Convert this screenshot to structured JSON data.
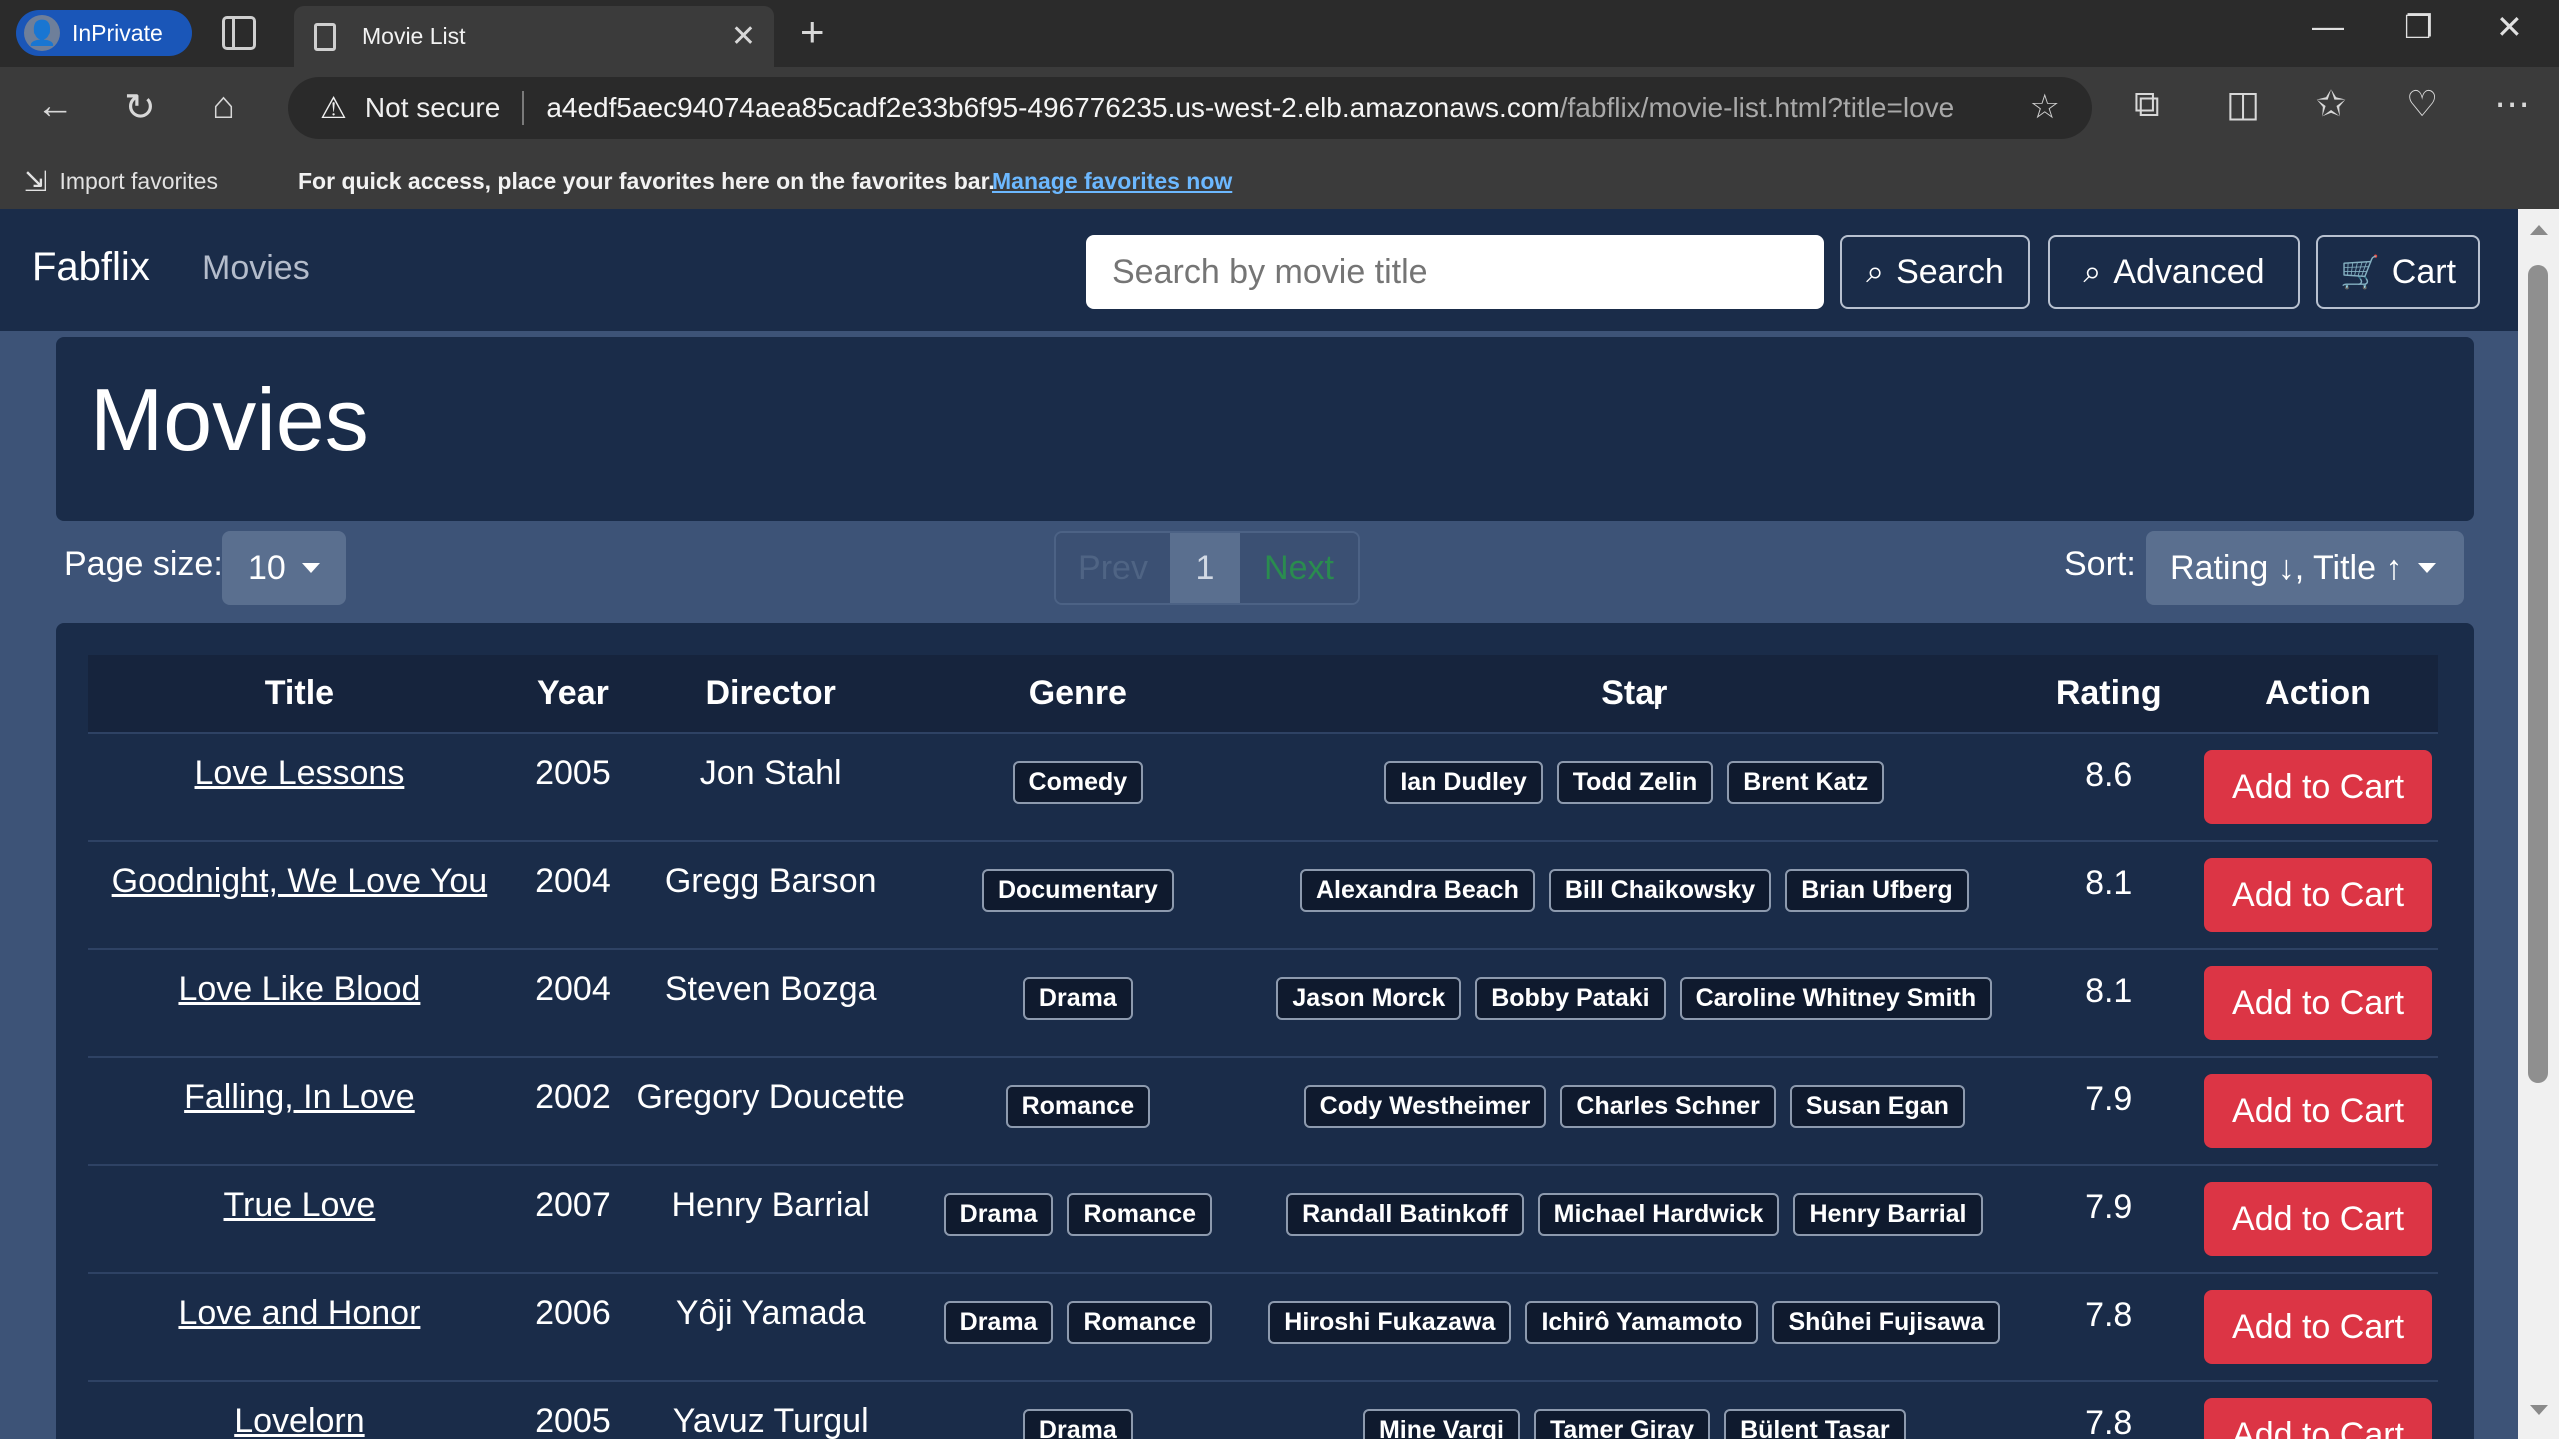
{
  "browser": {
    "inprivate_label": "InPrivate",
    "tab_title": "Movie List",
    "tab_close": "✕",
    "new_tab": "+",
    "security_label": "Not secure",
    "url_host": "a4edf5aec94074aea85cadf2e33b6f95-496776235.us-west-2.elb.amazonaws.com",
    "url_path": "/fabflix/movie-list.html?title=love",
    "favbar_import": "Import favorites",
    "favbar_message": "For quick access, place your favorites here on the favorites bar.",
    "favbar_link": "Manage favorites now"
  },
  "navbar": {
    "brand": "Fabflix",
    "movies_link": "Movies",
    "search_placeholder": "Search by movie title",
    "search_button": "Search",
    "advanced_button": "Advanced",
    "cart_button": "Cart"
  },
  "page": {
    "heading": "Movies",
    "page_size_label": "Page size:",
    "page_size_value": "10",
    "pager": {
      "prev": "Prev",
      "current": "1",
      "next": "Next"
    },
    "sort_label": "Sort:",
    "sort_value": "Rating ↓, Title ↑"
  },
  "table": {
    "headers": [
      "Title",
      "Year",
      "Director",
      "Genre",
      "Star",
      "Rating",
      "Action"
    ],
    "action_label": "Add to Cart",
    "rows": [
      {
        "title": "Love Lessons",
        "year": "2005",
        "director": "Jon Stahl",
        "genres": [
          "Comedy"
        ],
        "stars": [
          "Ian Dudley",
          "Todd Zelin",
          "Brent Katz"
        ],
        "rating": "8.6"
      },
      {
        "title": "Goodnight, We Love You",
        "year": "2004",
        "director": "Gregg Barson",
        "genres": [
          "Documentary"
        ],
        "stars": [
          "Alexandra Beach",
          "Bill Chaikowsky",
          "Brian Ufberg"
        ],
        "rating": "8.1"
      },
      {
        "title": "Love Like Blood",
        "year": "2004",
        "director": "Steven Bozga",
        "genres": [
          "Drama"
        ],
        "stars": [
          "Jason Morck",
          "Bobby Pataki",
          "Caroline Whitney Smith"
        ],
        "rating": "8.1"
      },
      {
        "title": "Falling, In Love",
        "year": "2002",
        "director": "Gregory Doucette",
        "genres": [
          "Romance"
        ],
        "stars": [
          "Cody Westheimer",
          "Charles Schner",
          "Susan Egan"
        ],
        "rating": "7.9"
      },
      {
        "title": "True Love",
        "year": "2007",
        "director": "Henry Barrial",
        "genres": [
          "Drama",
          "Romance"
        ],
        "stars": [
          "Randall Batinkoff",
          "Michael Hardwick",
          "Henry Barrial"
        ],
        "rating": "7.9"
      },
      {
        "title": "Love and Honor",
        "year": "2006",
        "director": "Yôji Yamada",
        "genres": [
          "Drama",
          "Romance"
        ],
        "stars": [
          "Hiroshi Fukazawa",
          "Ichirô Yamamoto",
          "Shûhei Fujisawa"
        ],
        "rating": "7.8"
      },
      {
        "title": "Lovelorn",
        "year": "2005",
        "director": "Yavuz Turgul",
        "genres": [
          "Drama"
        ],
        "stars": [
          "Mine Vargi",
          "Tamer Giray",
          "Bülent Tasar"
        ],
        "rating": "7.8"
      }
    ]
  },
  "colors": {
    "navbar_bg": "#1a2c49",
    "page_bg": "#3d5377",
    "danger": "#dc3545"
  }
}
